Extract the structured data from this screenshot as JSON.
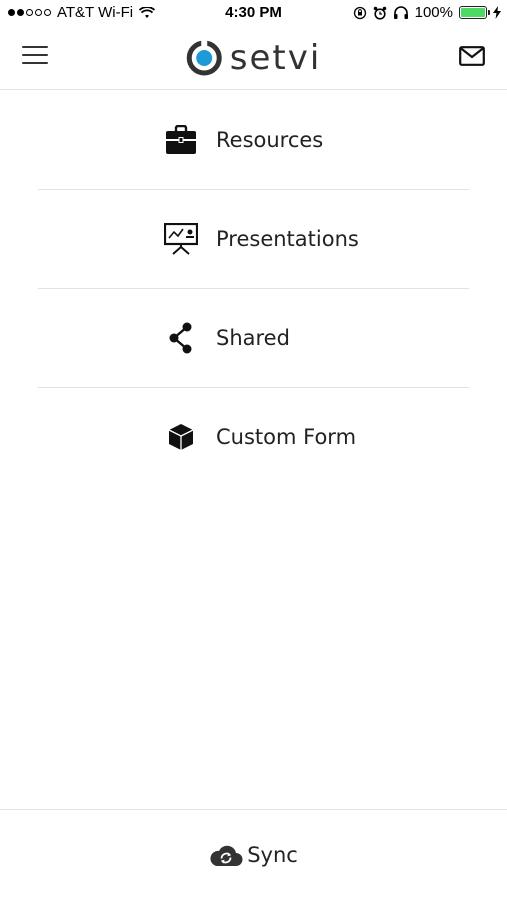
{
  "status_bar": {
    "carrier": "AT&T Wi-Fi",
    "time": "4:30 PM",
    "battery": "100%",
    "battery_level": 1.0,
    "battery_color": "#4cd964"
  },
  "nav": {
    "logo_text": "setvi",
    "logo_accent": "#1e9ad6",
    "menu_icon": "hamburger-icon",
    "mail_icon": "mail-icon"
  },
  "menu": {
    "items": [
      {
        "label": "Resources",
        "icon": "briefcase-icon"
      },
      {
        "label": "Presentations",
        "icon": "presentation-board-icon"
      },
      {
        "label": "Shared",
        "icon": "share-icon"
      },
      {
        "label": "Custom Form",
        "icon": "cube-icon"
      }
    ]
  },
  "footer": {
    "sync_label": "Sync",
    "sync_icon": "cloud-sync-icon"
  }
}
